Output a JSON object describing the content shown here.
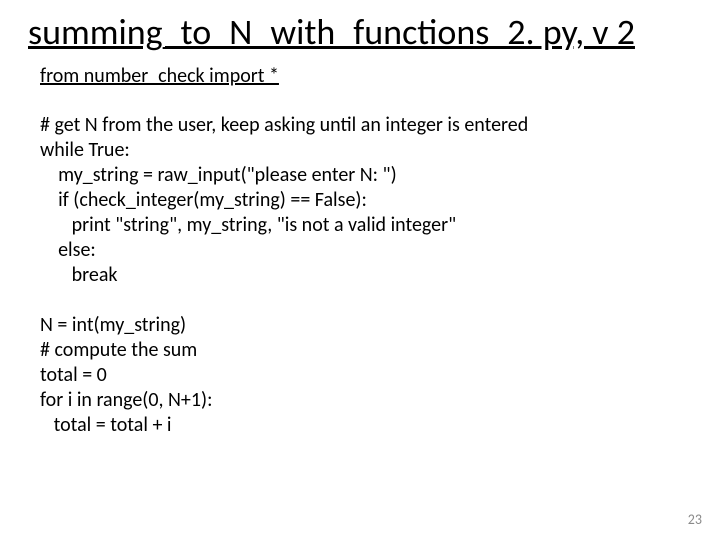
{
  "title": "summing_to_N_with_functions_2. py, v 2",
  "import_line": "from number_check import *",
  "code_lines": [
    "# get N from the user, keep asking until an integer is entered",
    "while True:",
    "    my_string = raw_input(\"please enter N: \")",
    "    if (check_integer(my_string) == False):",
    "       print \"string\", my_string, \"is not a valid integer\"",
    "    else:",
    "       break",
    "",
    "N = int(my_string)",
    "# compute the sum",
    "total = 0",
    "for i in range(0, N+1):",
    "   total = total + i"
  ],
  "page_number": "23"
}
